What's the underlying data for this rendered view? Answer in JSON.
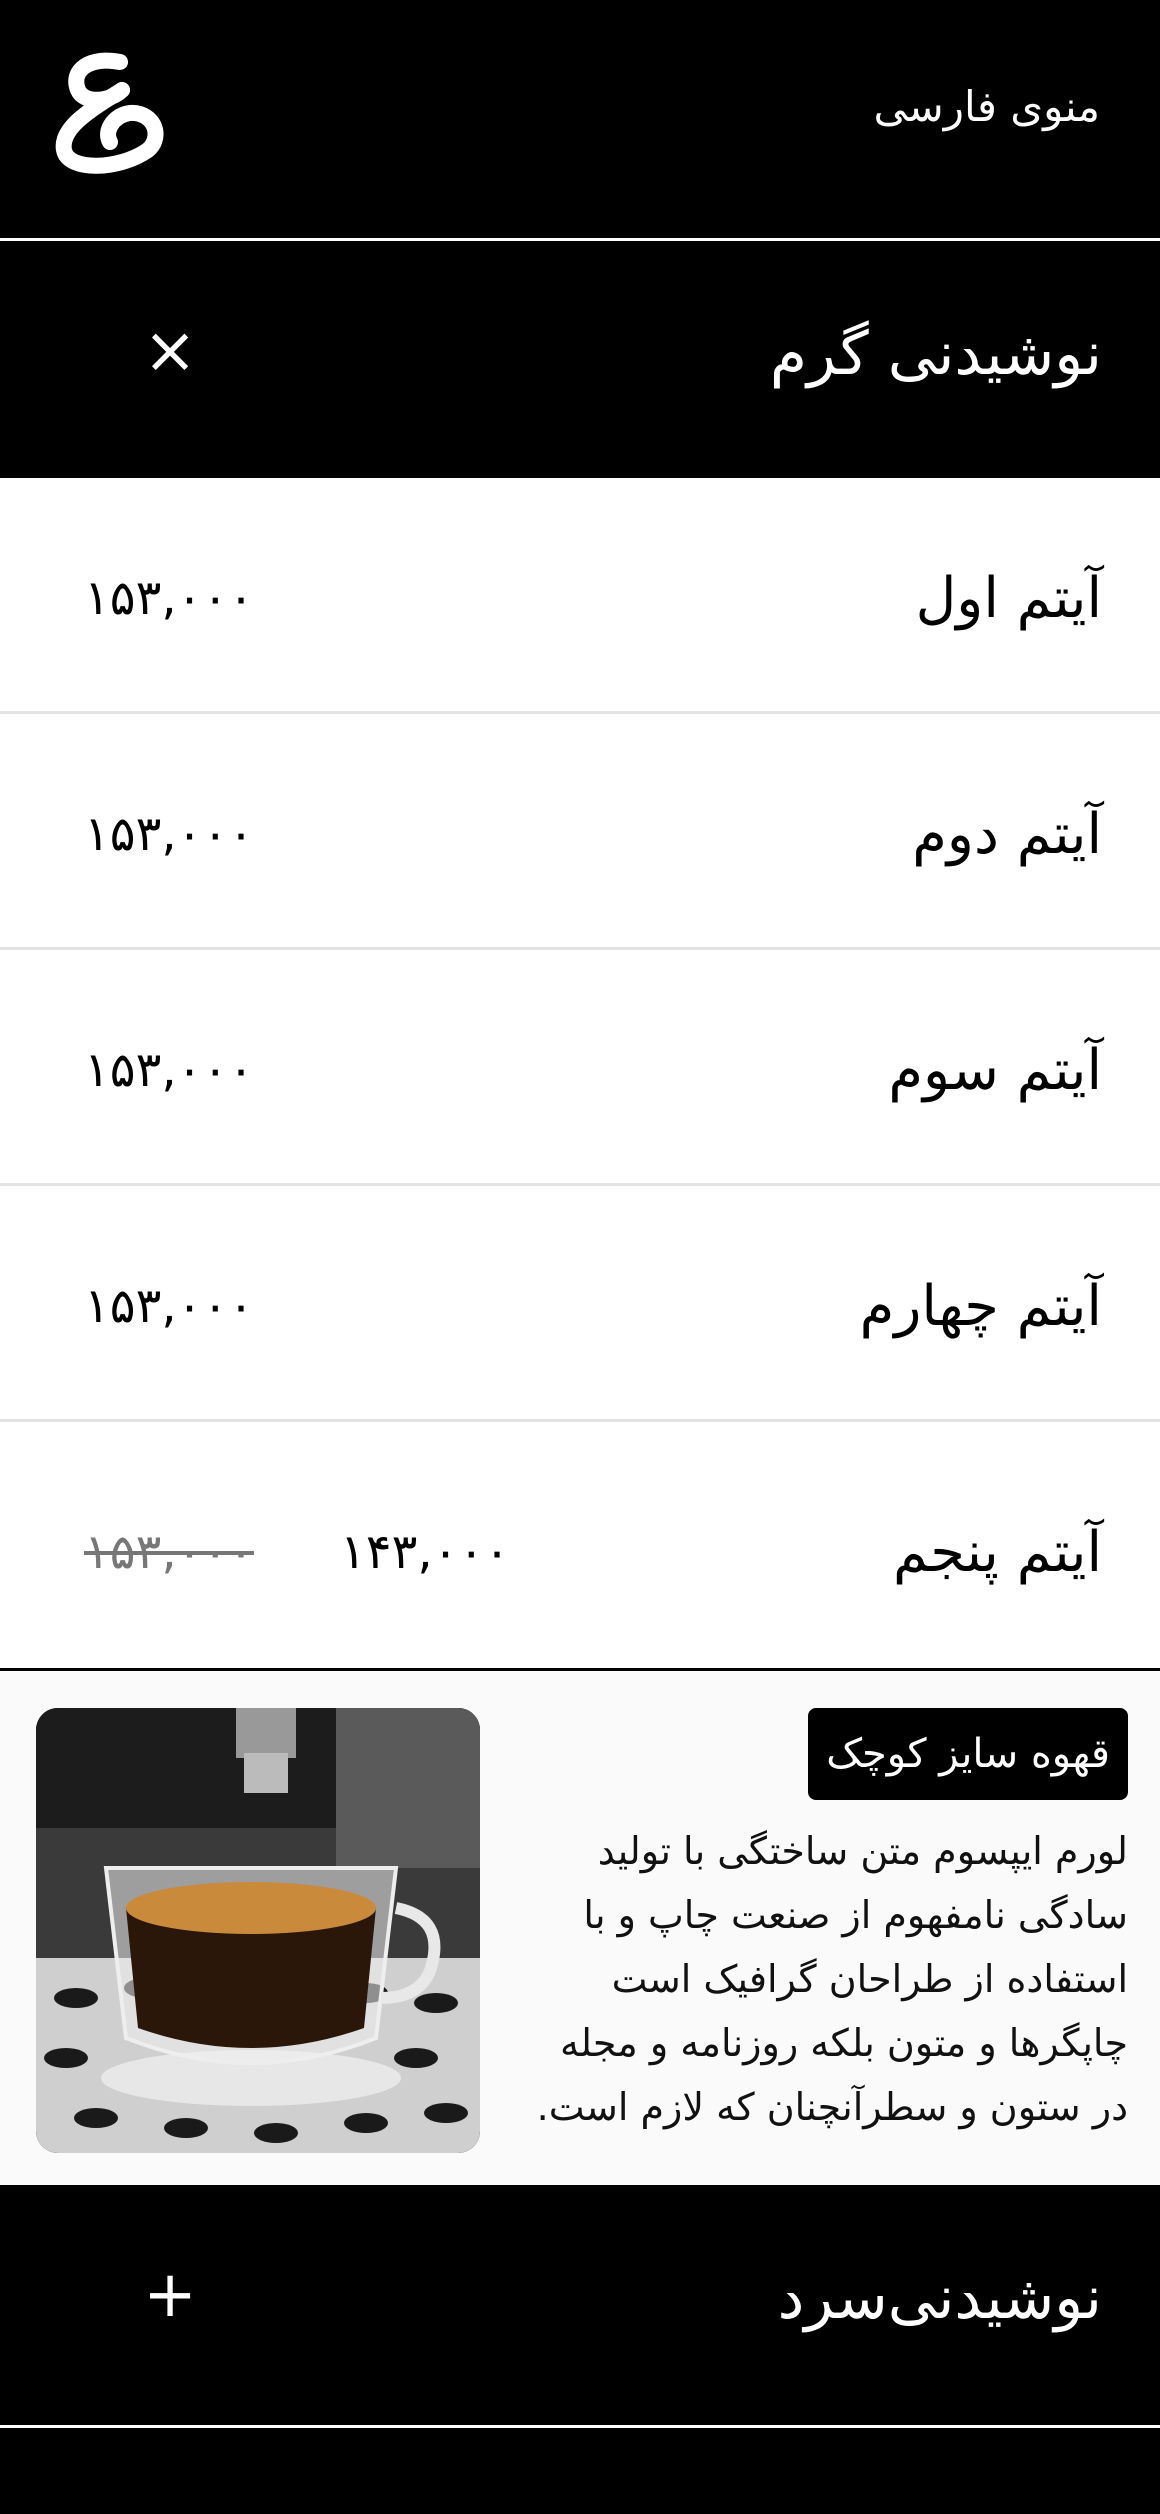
{
  "header": {
    "title": "منوی فارسی",
    "logo_icon": "calligraphy-logo-icon"
  },
  "categories": [
    {
      "title": "نوشیدنی گرم",
      "toggle": "×",
      "expanded": true
    },
    {
      "title": "نوشیدنی‌سرد",
      "toggle": "+",
      "expanded": false
    }
  ],
  "items": [
    {
      "name": "آیتم اول",
      "price": "۱۵۳,۰۰۰"
    },
    {
      "name": "آیتم دوم",
      "price": "۱۵۳,۰۰۰"
    },
    {
      "name": "آیتم سوم",
      "price": "۱۵۳,۰۰۰"
    },
    {
      "name": "آیتم چهارم",
      "price": "۱۵۳,۰۰۰"
    },
    {
      "name": "آیتم پنجم",
      "old_price": "۱۵۳,۰۰۰",
      "price": "۱۴۳,۰۰۰"
    }
  ],
  "promo": {
    "badge": "قهوه سایز کوچک",
    "description": "لورم ایپسوم متن ساختگی با تولید سادگی نامفهوم از صنعت چاپ و با استفاده از طراحان گرافیک است چاپگرها و متون بلکه روزنامه و مجله در ستون و سطرآنچنان که لازم است.",
    "image_icon": "espresso-cup-image"
  },
  "colors": {
    "header_bg": "#000000",
    "row_divider": "#e3e3e3",
    "old_price": "#777777"
  }
}
